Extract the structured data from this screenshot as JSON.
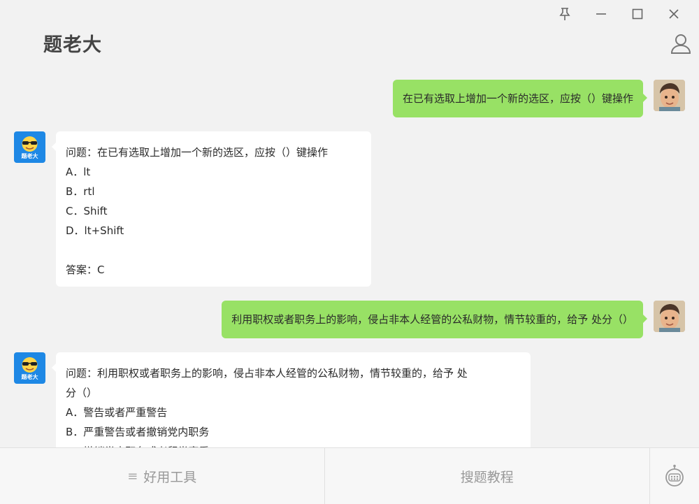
{
  "app": {
    "title": "题老大"
  },
  "window": {
    "pin_label": "pin",
    "minimize_label": "minimize",
    "maximize_label": "maximize",
    "close_label": "close"
  },
  "messages": [
    {
      "role": "user",
      "text": "在已有选取上增加一个新的选区，应按（）键操作"
    },
    {
      "role": "bot",
      "lines": [
        "问题：在已有选取上增加一个新的选区，应按（）键操作",
        "A．lt",
        "B．rtl",
        "C．Shift",
        "D．lt+Shift",
        "",
        "答案：C"
      ]
    },
    {
      "role": "user",
      "text": "利用职权或者职务上的影响，侵占非本人经管的公私财物，情节较重的，给予 处分（）"
    },
    {
      "role": "bot",
      "lines": [
        "问题：利用职权或者职务上的影响，侵占非本人经管的公私财物，情节较重的，给予 处",
        "分（）",
        "A．警告或者严重警告",
        "B．严重警告或者撤销党内职务",
        "C．撤销党内职务或者留党察看"
      ]
    }
  ],
  "bot_avatar_label": "题老大",
  "bottom": {
    "tools_label": "好用工具",
    "tutorial_label": "搜题教程"
  },
  "icons": {
    "pin": "pin-icon",
    "minimize": "minimize-icon",
    "maximize": "maximize-icon",
    "close": "close-icon",
    "user": "user-icon",
    "menu": "menu-icon",
    "robot": "robot-icon"
  },
  "colors": {
    "user_bubble": "#98e165",
    "bot_bubble": "#ffffff",
    "bot_avatar": "#1e88e5",
    "background": "#f2f2f2"
  }
}
